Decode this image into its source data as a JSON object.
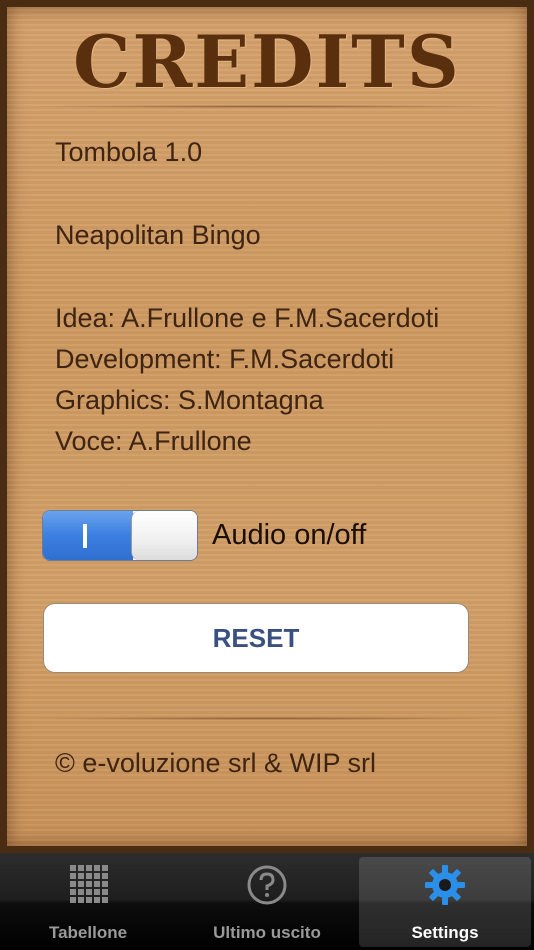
{
  "credits": {
    "title": "CREDITS",
    "app_version": "Tombola 1.0",
    "subtitle": "Neapolitan Bingo",
    "idea": "Idea: A.Frullone e F.M.Sacerdoti",
    "development": "Development: F.M.Sacerdoti",
    "graphics": "Graphics: S.Montagna",
    "voice": "Voce: A.Frullone",
    "copyright": "© e-voluzione srl & WIP srl"
  },
  "audio": {
    "label": "Audio on/off",
    "on_glyph": "I",
    "enabled": true
  },
  "reset": {
    "label": "RESET"
  },
  "tabs": [
    {
      "label": "Tabellone",
      "icon": "grid-icon",
      "selected": false
    },
    {
      "label": "Ultimo uscito",
      "icon": "question-icon",
      "selected": false
    },
    {
      "label": "Settings",
      "icon": "gear-icon",
      "selected": true
    }
  ],
  "colors": {
    "accent": "#3b7fe0",
    "wood": "#d3a068",
    "frame": "#4a2c13",
    "title": "#5a2f0e"
  }
}
